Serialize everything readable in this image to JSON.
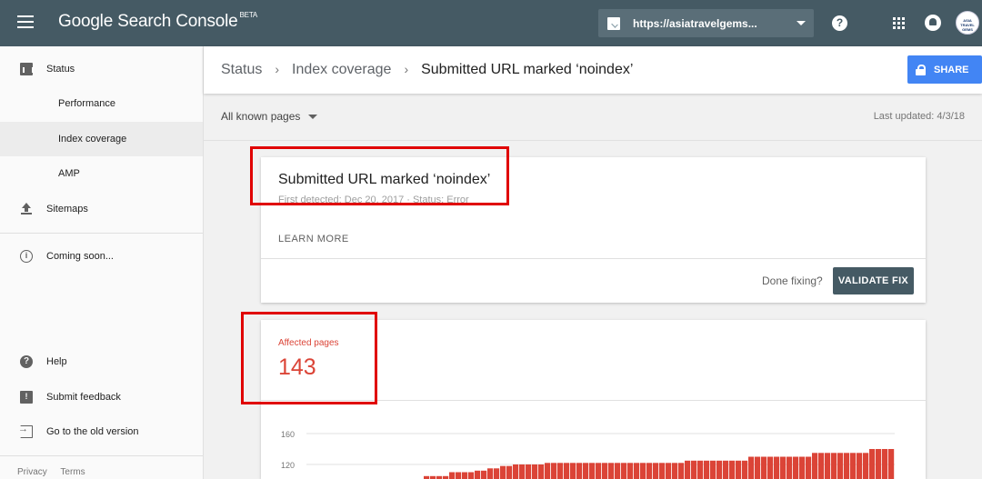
{
  "app": {
    "title": "Google Search Console",
    "badge": "BETA"
  },
  "topbar": {
    "property_url": "https://asiatravelgems...",
    "help_glyph": "?",
    "avatar_text": "ASIA TRAVEL GEMS"
  },
  "sidebar": {
    "items": [
      {
        "label": "Status",
        "icon": "bar-chart-icon"
      },
      {
        "label": "Performance"
      },
      {
        "label": "Index coverage",
        "active": true
      },
      {
        "label": "AMP"
      },
      {
        "label": "Sitemaps",
        "icon": "upload-icon"
      },
      {
        "label": "Coming soon...",
        "icon": "info-icon"
      },
      {
        "label": "Help",
        "icon": "help-icon"
      },
      {
        "label": "Submit feedback",
        "icon": "feedback-icon"
      },
      {
        "label": "Go to the old version",
        "icon": "exit-icon"
      }
    ],
    "footer": {
      "privacy": "Privacy",
      "terms": "Terms"
    }
  },
  "header": {
    "breadcrumb": [
      "Status",
      "Index coverage",
      "Submitted URL marked ‘noindex’"
    ],
    "share_label": "SHARE"
  },
  "filter": {
    "selected": "All known pages",
    "last_updated": "Last updated: 4/3/18"
  },
  "issue_card": {
    "title": "Submitted URL marked ‘noindex’",
    "meta": "First detected: Dec 20, 2017 · Status: Error",
    "learn_more": "LEARN MORE",
    "done_fixing": "Done fixing?",
    "validate_label": "VALIDATE FIX"
  },
  "affected_card": {
    "label": "Affected pages",
    "count": "143"
  },
  "chart_data": {
    "type": "bar",
    "color": "#db4437",
    "y_ticks": [
      "160",
      "120"
    ],
    "ylim": [
      100,
      160
    ],
    "values": [
      105,
      105,
      105,
      105,
      110,
      110,
      110,
      110,
      112,
      112,
      115,
      115,
      118,
      118,
      120,
      120,
      120,
      120,
      120,
      122,
      122,
      122,
      122,
      122,
      122,
      122,
      122,
      122,
      122,
      122,
      122,
      122,
      122,
      122,
      122,
      122,
      122,
      122,
      122,
      122,
      122,
      125,
      125,
      125,
      125,
      125,
      125,
      125,
      125,
      125,
      125,
      130,
      130,
      130,
      130,
      130,
      130,
      130,
      130,
      130,
      130,
      135,
      135,
      135,
      135,
      135,
      135,
      135,
      135,
      135,
      140,
      140,
      140,
      140
    ]
  },
  "colors": {
    "topbar": "#455a64",
    "accent_blue": "#4285f4",
    "error_red": "#db4437",
    "annotation_red": "#e00000"
  }
}
